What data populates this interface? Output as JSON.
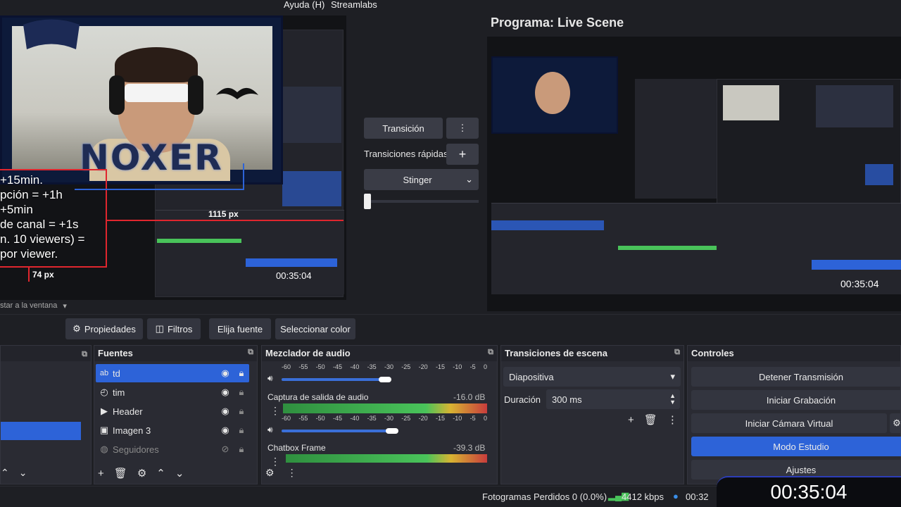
{
  "menubar": {
    "help": "Ayuda (H)",
    "streamlabs": "Streamlabs"
  },
  "preview": {
    "overlay_lines": [
      "+15min.",
      "pción = +1h",
      "+5min",
      "de canal = +1s",
      "n. 10 viewers) =",
      "por viewer."
    ],
    "logo_text": "NOXER",
    "px_label_1": "1115 px",
    "px_label_2": "74 px",
    "timer_small": "00:35:04",
    "adjust_text": "star a la ventana"
  },
  "transitions": {
    "transition_label": "Transición",
    "quick_label": "Transiciones rápidas",
    "selected": "Stinger"
  },
  "program": {
    "title": "Programa: Live Scene"
  },
  "toolbar": {
    "properties": "Propiedades",
    "filters": "Filtros",
    "choose_source": "Elija fuente",
    "select_color": "Seleccionar color"
  },
  "sources": {
    "title": "Fuentes",
    "items": [
      {
        "label": "td",
        "icon": "text-icon"
      },
      {
        "label": "tim",
        "icon": "clock-icon"
      },
      {
        "label": "Header",
        "icon": "play-icon"
      },
      {
        "label": "Imagen 3",
        "icon": "image-icon"
      },
      {
        "label": "Seguidores",
        "icon": "globe-icon"
      }
    ]
  },
  "mixer": {
    "title": "Mezclador de audio",
    "scale": [
      "-60",
      "-55",
      "-50",
      "-45",
      "-40",
      "-35",
      "-30",
      "-25",
      "-20",
      "-15",
      "-10",
      "-5",
      "0"
    ],
    "channels": [
      {
        "name": "Captura de salida de audio",
        "db": "-16.0 dB"
      },
      {
        "name": "Chatbox Frame",
        "db": "-39.3 dB"
      }
    ]
  },
  "scene_transitions": {
    "title": "Transiciones de escena",
    "selected": "Diapositiva",
    "duration_label": "Duración",
    "duration_value": "300 ms"
  },
  "controls": {
    "title": "Controles",
    "stop_stream": "Detener Transmisión",
    "start_recording": "Iniciar Grabación",
    "start_virtual_cam": "Iniciar Cámara Virtual",
    "studio_mode": "Modo Estudio",
    "settings": "Ajustes"
  },
  "status": {
    "dropped_frames": "Fotogramas Perdidos 0 (0.0%)",
    "bitrate": "4412 kbps",
    "time_partial": "00:32",
    "big_timer": "00:35:04"
  },
  "colors": {
    "accent": "#2d63d8",
    "background": "#1e1f24",
    "dock": "#2a2b33"
  }
}
